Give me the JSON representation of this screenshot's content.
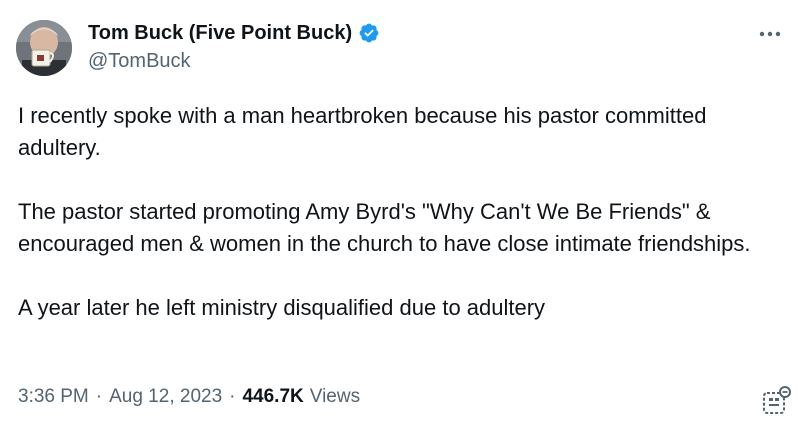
{
  "author": {
    "display_name": "Tom Buck (Five Point Buck)",
    "handle": "@TomBuck",
    "verified": true,
    "verified_color": "#1d9bf0"
  },
  "tweet": {
    "paragraphs": [
      "I recently spoke with a man heartbroken because his pastor committed adultery.",
      "The pastor started promoting Amy Byrd's \"Why Can't We Be Friends\" & encouraged men & women in the church to have close intimate friendships.",
      "A year later he left ministry disqualified due to adultery"
    ]
  },
  "meta": {
    "time": "3:36 PM",
    "separator": "·",
    "date": "Aug 12, 2023",
    "views_count": "446.7K",
    "views_label": "Views"
  },
  "icons": {
    "more": "more-options-icon",
    "verified": "verified-badge-icon",
    "grok": "grok-icon"
  }
}
